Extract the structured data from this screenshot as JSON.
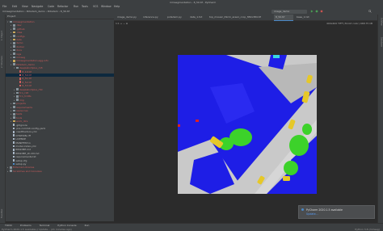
{
  "window": {
    "title": "mmsegmentation - 8_50.tif - PyCharm"
  },
  "menu": [
    "File",
    "Edit",
    "View",
    "Navigate",
    "Code",
    "Refactor",
    "Run",
    "Tools",
    "VCS",
    "Window",
    "Help"
  ],
  "navbar": {
    "breadcrumbs": [
      "mmsegmentation",
      "Potsdam_demo",
      "Potsdam",
      "8_50.tif"
    ],
    "run_config": "image_demo"
  },
  "left_strip": [
    "1: Project",
    "2: Structure",
    "Favorites"
  ],
  "right_strip": [
    "SciView",
    "Database"
  ],
  "project": {
    "header": "Project",
    "tree": [
      {
        "label": "mmsegmentation",
        "depth": 0,
        "icon": "folder",
        "open": true
      },
      {
        "label": ".dev",
        "depth": 1,
        "icon": "folder",
        "open": false
      },
      {
        "label": ".github",
        "depth": 1,
        "icon": "folder",
        "open": false
      },
      {
        "label": ".idea",
        "depth": 1,
        "icon": "folder y",
        "open": false
      },
      {
        "label": "configs",
        "depth": 1,
        "icon": "folder",
        "open": false
      },
      {
        "label": "data",
        "depth": 1,
        "icon": "folder y",
        "open": false
      },
      {
        "label": "demo",
        "depth": 1,
        "icon": "folder",
        "open": false
      },
      {
        "label": "docker",
        "depth": 1,
        "icon": "folder",
        "open": false
      },
      {
        "label": "docs",
        "depth": 1,
        "icon": "folder",
        "open": false
      },
      {
        "label": "logs",
        "depth": 1,
        "icon": "folder",
        "open": false
      },
      {
        "label": "mmseg",
        "depth": 1,
        "icon": "folder",
        "open": false
      },
      {
        "label": "mmsegmentation.egg-info",
        "depth": 1,
        "icon": "folder y",
        "open": false
      },
      {
        "label": "Potsdam_demo",
        "depth": 1,
        "icon": "folder",
        "open": true
      },
      {
        "label": "deeplabv3plus_r18",
        "depth": 2,
        "icon": "folder",
        "open": true
      },
      {
        "label": "8_10.tif",
        "depth": 3,
        "icon": "file r",
        "open": null
      },
      {
        "label": "8_50.tif",
        "depth": 3,
        "icon": "file r",
        "open": null,
        "selected": true
      },
      {
        "label": "8_51.tif",
        "depth": 3,
        "icon": "file r",
        "open": null
      },
      {
        "label": "8_52.tif",
        "depth": 3,
        "icon": "file r",
        "open": null
      },
      {
        "label": "8_53.tif",
        "depth": 3,
        "icon": "file r",
        "open": null
      },
      {
        "label": "deeplabv3plus_r50",
        "depth": 2,
        "icon": "folder",
        "open": false
      },
      {
        "label": "fcn_r18",
        "depth": 2,
        "icon": "folder",
        "open": false
      },
      {
        "label": "fcn_hr18s",
        "depth": 2,
        "icon": "folder",
        "open": false
      },
      {
        "label": "img",
        "depth": 2,
        "icon": "folder",
        "open": false
      },
      {
        "label": "projects",
        "depth": 1,
        "icon": "folder",
        "open": false
      },
      {
        "label": "requirements",
        "depth": 1,
        "icon": "folder",
        "open": false
      },
      {
        "label": "resources",
        "depth": 1,
        "icon": "folder",
        "open": false
      },
      {
        "label": "tests",
        "depth": 1,
        "icon": "folder",
        "open": false
      },
      {
        "label": "tools",
        "depth": 1,
        "icon": "folder",
        "open": false
      },
      {
        "label": "work_dirs",
        "depth": 1,
        "icon": "folder y",
        "open": false
      },
      {
        "label": ".gitignore",
        "depth": 1,
        "icon": "file",
        "open": null
      },
      {
        "label": ".pre-commit-config.yaml",
        "depth": 1,
        "icon": "file",
        "open": null
      },
      {
        "label": ".readthedocs.yml",
        "depth": 1,
        "icon": "file",
        "open": null
      },
      {
        "label": "CITATION.cff",
        "depth": 1,
        "icon": "file",
        "open": null
      },
      {
        "label": "LICENSE",
        "depth": 1,
        "icon": "file",
        "open": null
      },
      {
        "label": "MANIFEST.in",
        "depth": 1,
        "icon": "file",
        "open": null
      },
      {
        "label": "model-index.yml",
        "depth": 1,
        "icon": "file",
        "open": null
      },
      {
        "label": "README.md",
        "depth": 1,
        "icon": "file",
        "open": null
      },
      {
        "label": "README_zh-CN.md",
        "depth": 1,
        "icon": "file",
        "open": null
      },
      {
        "label": "requirements.txt",
        "depth": 1,
        "icon": "file",
        "open": null
      },
      {
        "label": "setup.cfg",
        "depth": 1,
        "icon": "file",
        "open": null
      },
      {
        "label": "setup.py",
        "depth": 1,
        "icon": "file p",
        "open": null
      },
      {
        "label": "External Libraries",
        "depth": 0,
        "icon": "folder",
        "open": false
      },
      {
        "label": "Scratches and Consoles",
        "depth": 0,
        "icon": "folder",
        "open": false
      }
    ]
  },
  "tabs": [
    {
      "label": "image_demo.py",
      "active": false
    },
    {
      "label": "inference.py",
      "active": false
    },
    {
      "label": "potsdam.py",
      "active": false
    },
    {
      "label": "data_1.txt",
      "active": false
    },
    {
      "label": "top_mosaic_09cm_area1_crop_384x384.tif",
      "active": false
    },
    {
      "label": "8_50.tif",
      "active": true
    },
    {
      "label": "base_1.txt",
      "active": false
    }
  ],
  "image_info": "400x400 TIFF (32-bit color) 468.75 kB",
  "image_toolbar": "1:1  +  −  ⊡",
  "status": {
    "bottom_tabs": [
      "TODO",
      "Problems",
      "Terminal",
      "Python Console",
      "Run"
    ],
    "message": "PyCharm 2020.1.5 available // Update... (21 minutes ago)",
    "right": "Python 3.8 (mmseg)"
  },
  "notification": {
    "title": "PyCharm 2020.1.5 available",
    "action": "Update..."
  },
  "colors": {
    "impervious": "#c9c9c9",
    "building": "#1e1ee6",
    "lowveg": "#3ad8e0",
    "tree": "#3cd22a",
    "car": "#e6c828",
    "clutter": "#e02020"
  }
}
